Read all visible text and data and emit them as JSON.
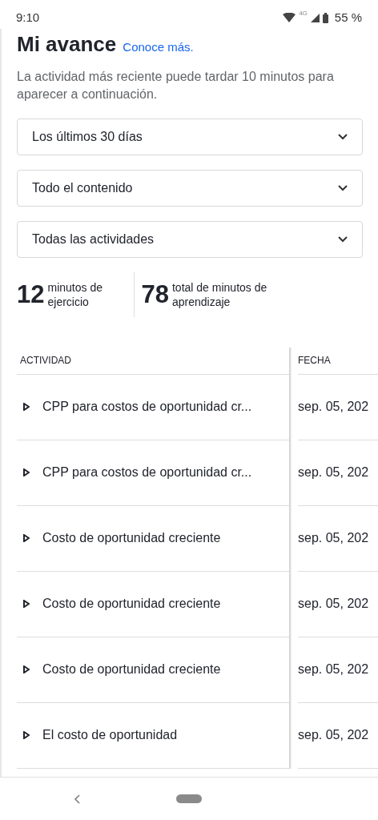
{
  "status_bar": {
    "time": "9:10",
    "network": "4G",
    "battery": "55 %"
  },
  "header": {
    "title": "Mi avance",
    "link": "Conoce más."
  },
  "description": "La actividad más reciente puede tardar 10 minutos para aparecer a continuación.",
  "filters": [
    {
      "value": "Los últimos 30 días"
    },
    {
      "value": "Todo el contenido"
    },
    {
      "value": "Todas las actividades"
    }
  ],
  "stats": [
    {
      "number": "12",
      "label": "minutos de ejercicio"
    },
    {
      "number": "78",
      "label": "total de minutos de aprendizaje"
    }
  ],
  "table": {
    "columns": [
      "ACTIVIDAD",
      "FECHA"
    ],
    "rows": [
      {
        "activity": "CPP para costos de oportunidad cr...",
        "date": "sep. 05, 202"
      },
      {
        "activity": "CPP para costos de oportunidad cr...",
        "date": "sep. 05, 202"
      },
      {
        "activity": "Costo de oportunidad creciente",
        "date": "sep. 05, 202"
      },
      {
        "activity": "Costo de oportunidad creciente",
        "date": "sep. 05, 202"
      },
      {
        "activity": "Costo de oportunidad creciente",
        "date": "sep. 05, 202"
      },
      {
        "activity": "El costo de oportunidad",
        "date": "sep. 05, 202"
      }
    ]
  }
}
